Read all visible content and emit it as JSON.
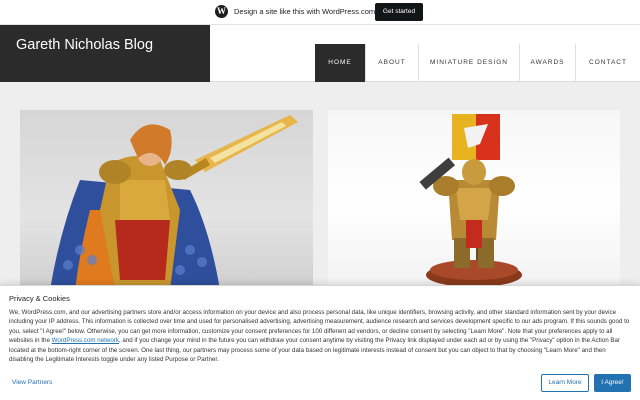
{
  "promo_bar": {
    "icon": "wordpress-logo-icon",
    "text": "Design a site like this with WordPress.com",
    "button_label": "Get started"
  },
  "header": {
    "site_title": "Gareth Nicholas Blog",
    "nav": [
      {
        "label": "HOME",
        "active": true
      },
      {
        "label": "ABOUT",
        "active": false
      },
      {
        "label": "MINIATURE DESIGN",
        "active": false
      },
      {
        "label": "AWARDS",
        "active": false
      },
      {
        "label": "CONTACT",
        "active": false
      }
    ]
  },
  "posts": [
    {
      "image": "painted-miniature-golden-warrior-with-sword-photo"
    },
    {
      "image": "painted-miniature-golden-armored-soldier-with-banner-photo"
    }
  ],
  "cookie_banner": {
    "title": "Privacy & Cookies",
    "body_before_link": "We, WordPress.com, and our advertising partners store and/or access information on your device and also process personal data, like unique identifiers, browsing activity, and other standard information sent by your device including your IP address. This information is collected over time and used for personalised advertising, advertising measurement, audience research and services development specific to our ads program. If this sounds good to you, select \"I Agree!\" below. Otherwise, you can get more information, customize your consent preferences for 100 different ad vendors, or decline consent by selecting \"Learn More\". Note that your preferences apply to all websites in the ",
    "link_text": "WordPress.com network",
    "body_after_link": ", and if you change your mind in the future you can withdraw your consent anytime by visiting the Privacy link displayed under each ad or by using the \"Privacy\" option in the Action Bar located at the bottom-right corner of the screen. One last thing, our partners may process some of your data based on legitimate interests instead of consent but you can object to that by choosing \"Learn More\" and then disabling the Legitimate Interests toggle under any listed Purpose or Partner.",
    "view_partners_label": "View Partners",
    "learn_more_label": "Learn More",
    "agree_label": "I Agree!"
  },
  "colors": {
    "header_dark": "#2b2b2b",
    "link_blue": "#2271b1",
    "background": "#eeeeee"
  }
}
